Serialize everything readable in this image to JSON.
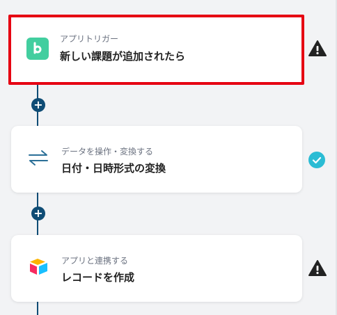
{
  "steps": [
    {
      "subtitle": "アプリトリガー",
      "title": "新しい課題が追加されたら",
      "icon": "backlog-app-icon",
      "status": "warning"
    },
    {
      "subtitle": "データを操作・変換する",
      "title": "日付・日時形式の変換",
      "icon": "convert-arrows-icon",
      "status": "complete"
    },
    {
      "subtitle": "アプリと連携する",
      "title": "レコードを作成",
      "icon": "airtable-app-icon",
      "status": "warning"
    }
  ],
  "colors": {
    "selection_border": "#e60012",
    "flow_line": "#0f4c75",
    "backlog_green": "#42ce9f",
    "check_teal": "#2bbcd4"
  }
}
